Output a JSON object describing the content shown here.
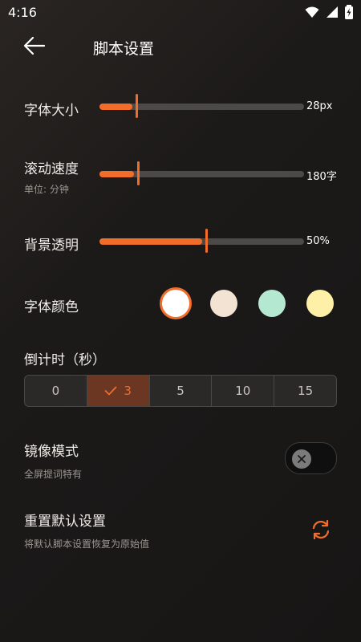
{
  "status_bar": {
    "time": "4:16",
    "icons": [
      "wifi-icon",
      "signal-icon",
      "battery-charging-icon"
    ]
  },
  "header": {
    "title": "脚本设置",
    "back_icon": "arrow-left-icon"
  },
  "font_size": {
    "label": "字体大小",
    "value": "28px",
    "level": 0.16
  },
  "scroll_speed": {
    "label": "滚动速度",
    "sublabel": "单位: 分钟",
    "value": "180字",
    "level": 0.17
  },
  "background_opacity": {
    "label": "背景透明",
    "value": "50%",
    "level": 0.5
  },
  "font_color": {
    "label": "字体颜色",
    "options": [
      "#ffffff",
      "#f3e3d3",
      "#b5e8d1",
      "#fff0a8"
    ],
    "selected_index": 0
  },
  "countdown": {
    "label": "倒计时（秒）",
    "options": [
      "0",
      "3",
      "5",
      "10",
      "15"
    ],
    "selected_index": 1
  },
  "mirror_mode": {
    "label": "镜像模式",
    "sublabel": "全屏提词特有",
    "enabled": false
  },
  "reset": {
    "label": "重置默认设置",
    "sublabel": "将默认脚本设置恢复为原始值",
    "icon": "refresh-icon"
  },
  "colors": {
    "accent": "#f26d2a",
    "track": "#4b4a48",
    "text": "#f0ede9",
    "subtext": "#9b9792"
  }
}
